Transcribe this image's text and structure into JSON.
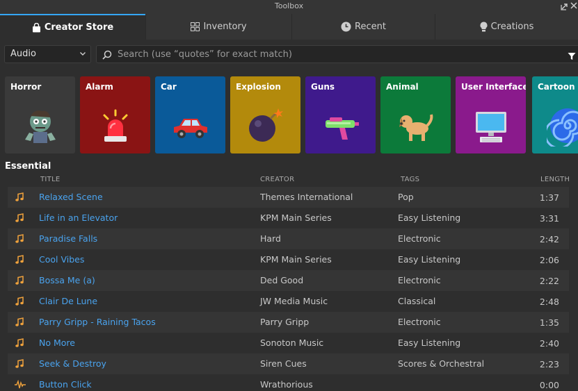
{
  "window": {
    "title": "Toolbox"
  },
  "tabs": [
    {
      "label": "Creator Store",
      "icon": "shopping-bag-icon",
      "active": true
    },
    {
      "label": "Inventory",
      "icon": "grid-icon",
      "active": false
    },
    {
      "label": "Recent",
      "icon": "clock-icon",
      "active": false
    },
    {
      "label": "Creations",
      "icon": "lightbulb-icon",
      "active": false
    }
  ],
  "filter": {
    "category_value": "Audio"
  },
  "search": {
    "placeholder": "Search (use “quotes” for exact match)",
    "value": ""
  },
  "categories": [
    {
      "label": "Horror",
      "color": "#3a3a3a",
      "icon": "zombie-icon"
    },
    {
      "label": "Alarm",
      "color": "#8a1414",
      "icon": "siren-icon"
    },
    {
      "label": "Car",
      "color": "#0a5a99",
      "icon": "car-icon"
    },
    {
      "label": "Explosion",
      "color": "#b38a0c",
      "icon": "bomb-icon"
    },
    {
      "label": "Guns",
      "color": "#3f1a8c",
      "icon": "water-gun-icon"
    },
    {
      "label": "Animal",
      "color": "#0c7a3a",
      "icon": "dog-icon"
    },
    {
      "label": "User Interface",
      "color": "#8a1a8c",
      "icon": "computer-icon"
    },
    {
      "label": "Cartoon",
      "color": "#0e8a8a",
      "icon": "spiral-icon"
    }
  ],
  "section": {
    "title": "Essential"
  },
  "columns": {
    "title": "TITLE",
    "creator": "CREATOR",
    "tags": "TAGS",
    "length": "LENGTH"
  },
  "tracks": [
    {
      "title": "Relaxed Scene",
      "creator": "Themes International",
      "tags": "Pop",
      "length": "1:37",
      "icon": "music-note-icon"
    },
    {
      "title": "Life in an Elevator",
      "creator": "KPM Main Series",
      "tags": "Easy Listening",
      "length": "3:31",
      "icon": "music-note-icon"
    },
    {
      "title": "Paradise Falls",
      "creator": "Hard",
      "tags": "Electronic",
      "length": "2:42",
      "icon": "music-note-icon"
    },
    {
      "title": "Cool Vibes",
      "creator": "KPM Main Series",
      "tags": "Easy Listening",
      "length": "2:06",
      "icon": "music-note-icon"
    },
    {
      "title": "Bossa Me (a)",
      "creator": "Ded Good",
      "tags": "Electronic",
      "length": "2:22",
      "icon": "music-note-icon"
    },
    {
      "title": "Clair De Lune",
      "creator": "JW Media Music",
      "tags": "Classical",
      "length": "2:48",
      "icon": "music-note-icon"
    },
    {
      "title": "Parry Gripp - Raining Tacos",
      "creator": "Parry Gripp",
      "tags": "Electronic",
      "length": "1:35",
      "icon": "music-note-icon"
    },
    {
      "title": "No More",
      "creator": "Sonoton Music",
      "tags": "Easy Listening",
      "length": "2:40",
      "icon": "music-note-icon"
    },
    {
      "title": "Seek & Destroy",
      "creator": "Siren Cues",
      "tags": "Scores & Orchestral",
      "length": "2:23",
      "icon": "music-note-icon"
    },
    {
      "title": "Button Click",
      "creator": "Wrathorious",
      "tags": "",
      "length": "0:00",
      "icon": "waveform-icon"
    }
  ],
  "colors": {
    "accent": "#35a7ff",
    "link": "#4aa3ee",
    "note_icon": "#f0a23c"
  }
}
